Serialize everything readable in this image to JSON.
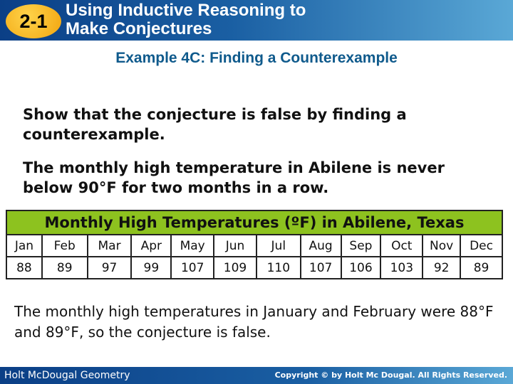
{
  "header": {
    "badge": "2-1",
    "title_line1": "Using Inductive Reasoning to",
    "title_line2": "Make Conjectures"
  },
  "example_title": "Example 4C: Finding a Counterexample",
  "instruction": "Show that the conjecture is false by finding a counterexample.",
  "conjecture": "The monthly high temperature in Abilene is never below 90°F for two months in a row.",
  "table": {
    "title": "Monthly High Temperatures (ºF) in Abilene, Texas",
    "months": [
      "Jan",
      "Feb",
      "Mar",
      "Apr",
      "May",
      "Jun",
      "Jul",
      "Aug",
      "Sep",
      "Oct",
      "Nov",
      "Dec"
    ],
    "temps": [
      "88",
      "89",
      "97",
      "99",
      "107",
      "109",
      "110",
      "107",
      "106",
      "103",
      "92",
      "89"
    ]
  },
  "conclusion": "The monthly high temperatures in January and February were 88°F and 89°F, so the conjecture is false.",
  "footer": {
    "left": "Holt McDougal Geometry",
    "right": "Copyright © by Holt Mc Dougal. All Rights Reserved."
  }
}
